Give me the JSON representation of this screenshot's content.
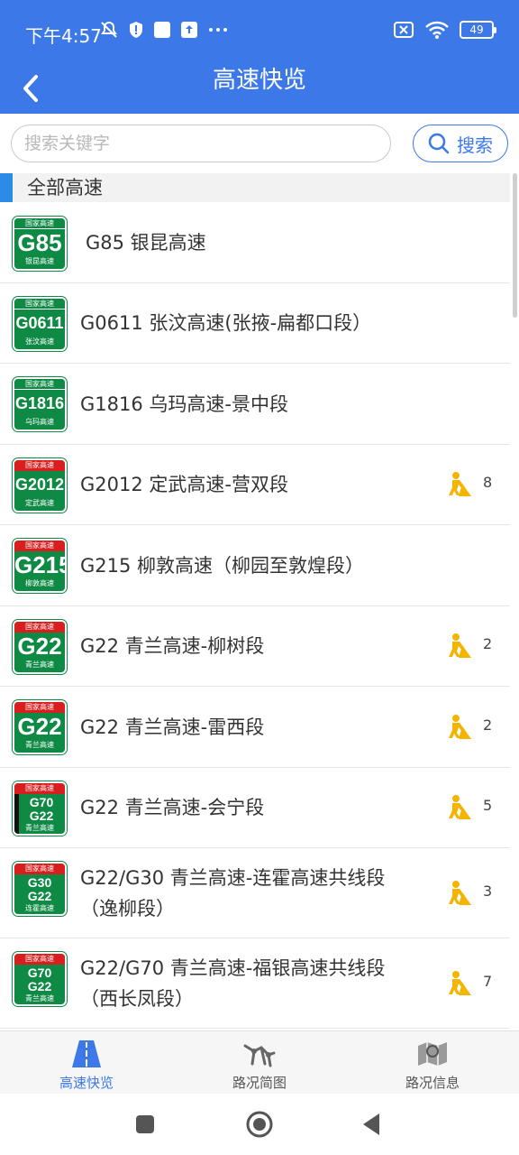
{
  "status_bar": {
    "time": "下午4:57",
    "battery": "49"
  },
  "header": {
    "title": "高速快览"
  },
  "search": {
    "placeholder": "搜索关键字",
    "button_label": "搜索"
  },
  "section": {
    "title": "全部高速"
  },
  "rows": [
    {
      "title": "G85 银昆高速",
      "shield_code": "G85",
      "shield_sub": "银昆高速",
      "shield_top": "国家高速",
      "work_count": ""
    },
    {
      "title": "G0611 张汶高速(张掖-扁都口段）",
      "shield_code": "G0611",
      "shield_sub": "张汶高速",
      "shield_top": "国家高速",
      "work_count": ""
    },
    {
      "title": "G1816 乌玛高速-景中段",
      "shield_code": "G1816",
      "shield_sub": "乌玛高速",
      "shield_top": "国家高速",
      "work_count": ""
    },
    {
      "title": "G2012 定武高速-营双段",
      "shield_code": "G2012",
      "shield_sub": "定武高速",
      "shield_top": "国家高速",
      "work_count": "8"
    },
    {
      "title": "G215 柳敦高速（柳园至敦煌段）",
      "shield_code": "G215",
      "shield_sub": "柳敦高速",
      "shield_top": "国家高速",
      "work_count": ""
    },
    {
      "title": "G22 青兰高速-柳树段",
      "shield_code": "G22",
      "shield_sub": "青兰高速",
      "shield_top": "国家高速",
      "work_count": "2"
    },
    {
      "title": "G22 青兰高速-雷西段",
      "shield_code": "G22",
      "shield_sub": "青兰高速",
      "shield_top": "国家高速",
      "work_count": "2"
    },
    {
      "title": "G22 青兰高速-会宁段",
      "shield_code": "G70 G22",
      "shield_sub": "青兰高速",
      "shield_top": "国家高速",
      "work_count": "5"
    },
    {
      "title": "G22/G30 青兰高速-连霍高速共线段（逸柳段）",
      "title_line1": "G22/G30 青兰高速-连霍高速共线段",
      "title_line2": "（逸柳段）",
      "shield_code": "G30 G22",
      "shield_sub": "连霍高速",
      "shield_top": "国家高速",
      "work_count": "3"
    },
    {
      "title": "G22/G70 青兰高速-福银高速共线段（西长凤段）",
      "title_line1": "G22/G70 青兰高速-福银高速共线段",
      "title_line2": "（西长凤段）",
      "shield_code": "G70 G22",
      "shield_sub": "青兰高速",
      "shield_top": "国家高速",
      "work_count": "7"
    }
  ],
  "tabs": [
    {
      "label": "高速快览",
      "icon": "highway-icon"
    },
    {
      "label": "路况简图",
      "icon": "road-map-icon"
    },
    {
      "label": "路况信息",
      "icon": "map-info-icon"
    }
  ],
  "colors": {
    "primary": "#3c78e8",
    "shield_green": "#0f8a45",
    "shield_red": "#d81e1e",
    "work_yellow": "#f4b400"
  }
}
